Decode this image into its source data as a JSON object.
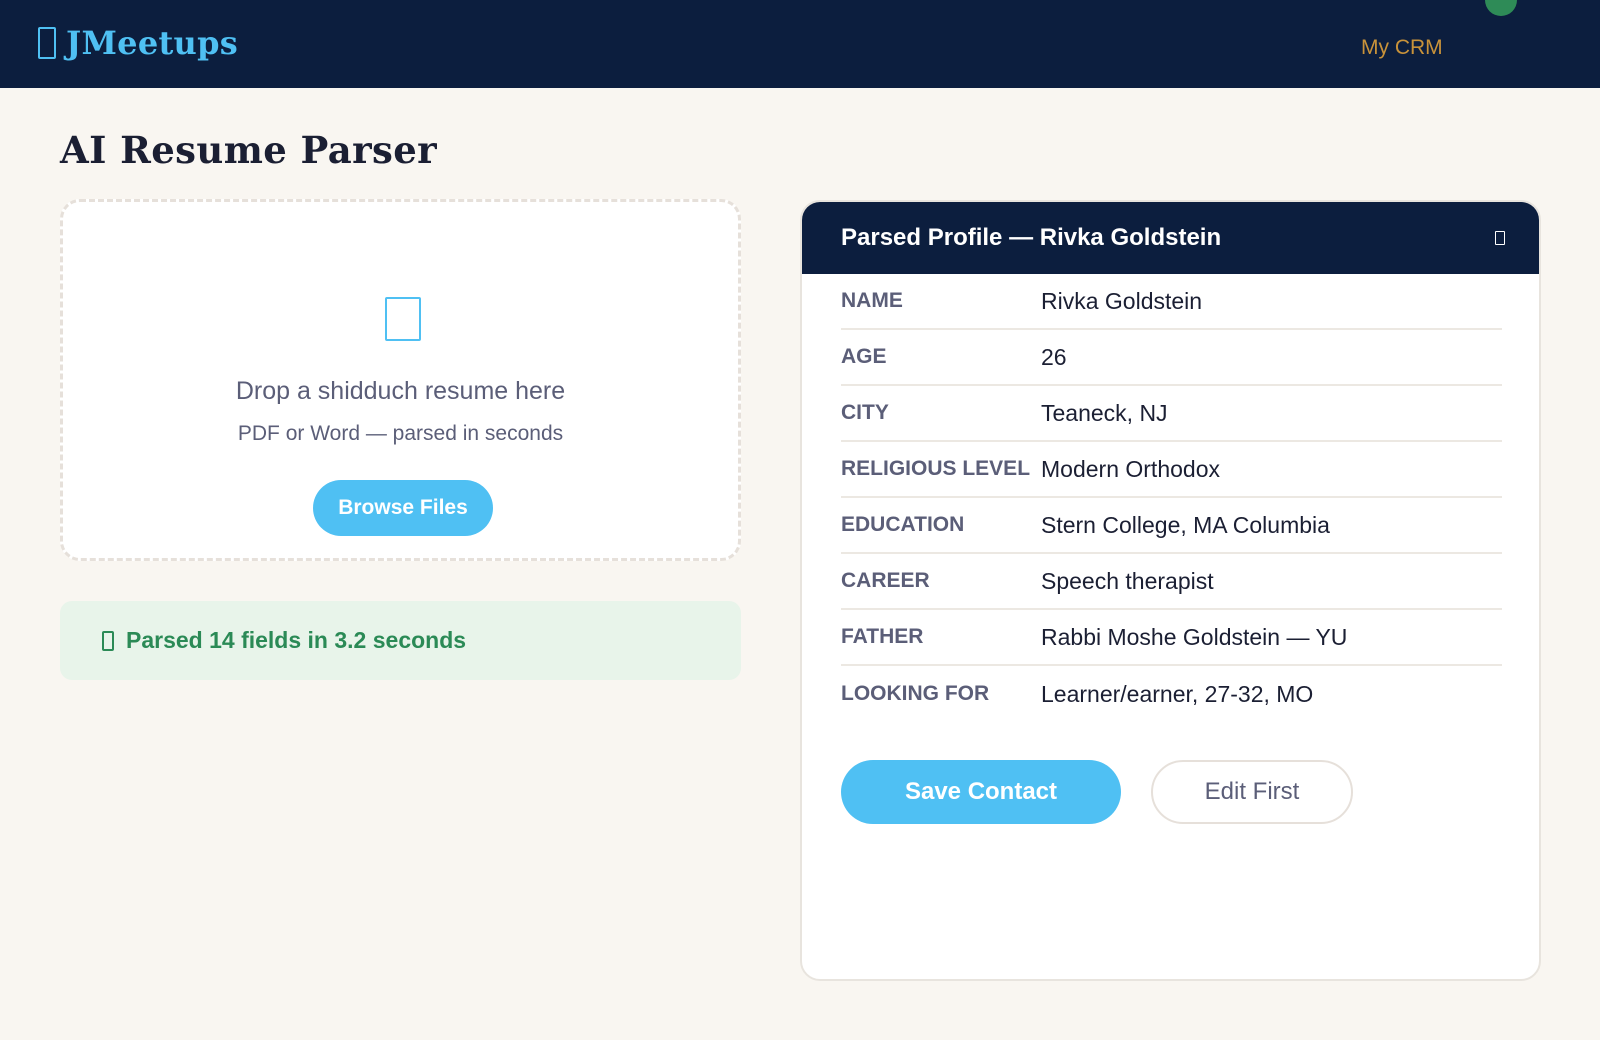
{
  "header": {
    "brand_name": "JMeetups",
    "brand_icon": "document-icon",
    "nav_crm": "My CRM",
    "colors": {
      "bar": "#0c1e3e",
      "brand": "#4fc0f3",
      "nav_link": "#c9933a",
      "user_dot": "#2e8b57"
    }
  },
  "page": {
    "title": "AI Resume Parser"
  },
  "upload": {
    "icon": "upload-file-icon",
    "title": "Drop a shidduch resume here",
    "subtitle": "PDF or Word — parsed in seconds",
    "browse_label": "Browse Files"
  },
  "status": {
    "icon": "check-icon",
    "text": "Parsed 14 fields in 3.2 seconds",
    "color": "#2b8a56"
  },
  "profile": {
    "title": "Parsed Profile — Rivka Goldstein",
    "close_icon": "close-icon",
    "fields": [
      {
        "label": "NAME",
        "value": "Rivka Goldstein"
      },
      {
        "label": "AGE",
        "value": "26"
      },
      {
        "label": "CITY",
        "value": "Teaneck, NJ"
      },
      {
        "label": "RELIGIOUS LEVEL",
        "value": "Modern Orthodox"
      },
      {
        "label": "EDUCATION",
        "value": "Stern College, MA Columbia"
      },
      {
        "label": "CAREER",
        "value": "Speech therapist"
      },
      {
        "label": "FATHER",
        "value": "Rabbi Moshe Goldstein — YU"
      },
      {
        "label": "LOOKING FOR",
        "value": "Learner/earner, 27-32, MO"
      }
    ],
    "save_label": "Save Contact",
    "edit_label": "Edit First",
    "accent": "#4fc0f3"
  }
}
